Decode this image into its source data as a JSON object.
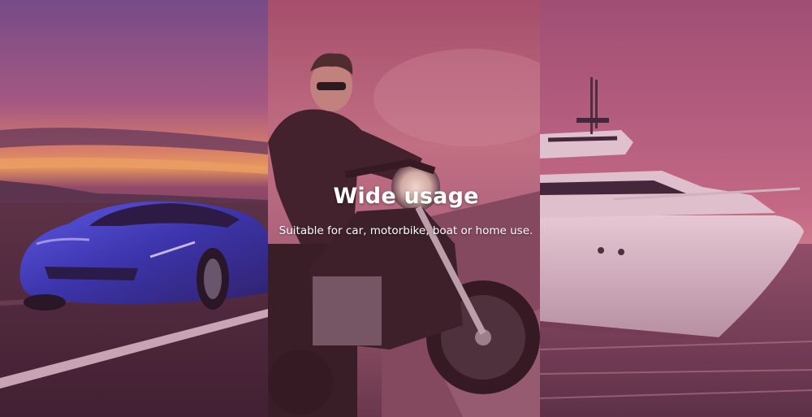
{
  "banner": {
    "title": "Wide usage",
    "subtitle": "Suitable for car, motorbike, boat or home use."
  },
  "panels": [
    {
      "subject": "car-photo",
      "accent": "#2b33c9"
    },
    {
      "subject": "motorbike-photo",
      "accent": "#3a2228"
    },
    {
      "subject": "boat-photo",
      "accent": "#e6d6dc"
    }
  ],
  "colors": {
    "overlay": "#b4466e",
    "text": "#ffffff"
  }
}
